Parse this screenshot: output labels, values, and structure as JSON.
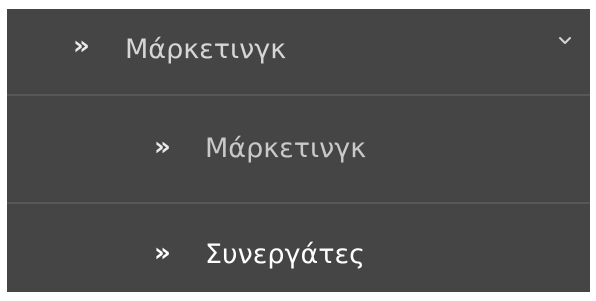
{
  "menu": {
    "parent": {
      "arrow_icon": "double-chevron-right-icon",
      "arrow_glyph": "»",
      "label": "Μάρκετινγκ",
      "expand_icon": "chevron-down-icon"
    },
    "submenu": [
      {
        "arrow_glyph": "»",
        "label": "Μάρκετινγκ"
      },
      {
        "arrow_glyph": "»",
        "label": "Συνεργάτες"
      }
    ]
  },
  "colors": {
    "background": "#454545",
    "divider": "#575757",
    "text_muted": "#c9c9c9",
    "text_active": "#ffffff"
  }
}
